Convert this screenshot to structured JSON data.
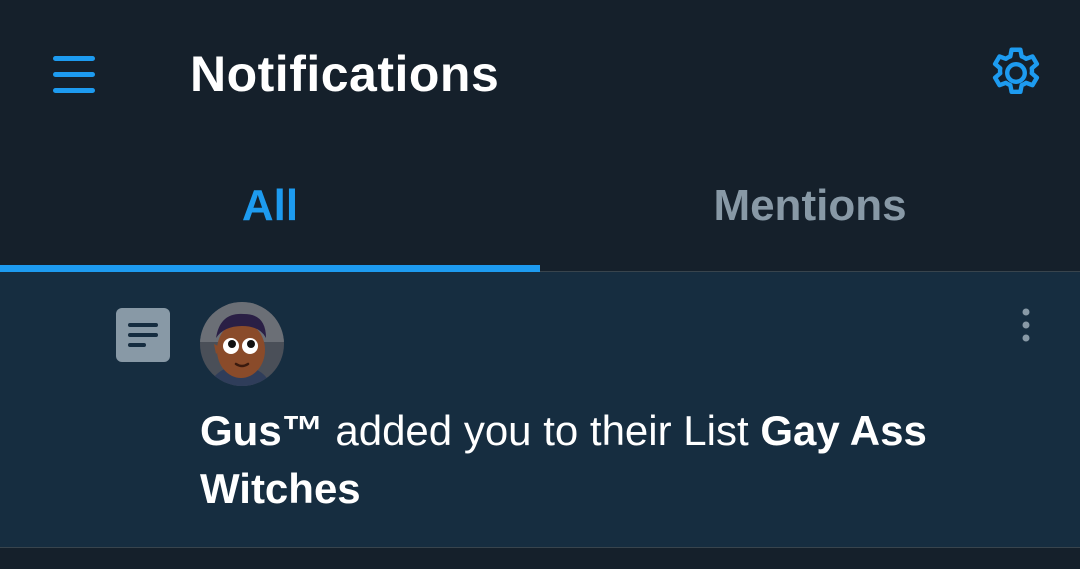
{
  "header": {
    "title": "Notifications",
    "menu_icon": "hamburger-menu-icon",
    "settings_icon": "gear-icon"
  },
  "tabs": [
    {
      "label": "All",
      "active": true
    },
    {
      "label": "Mentions",
      "active": false
    }
  ],
  "notification": {
    "type_icon": "list-icon",
    "user_name": "Gus™",
    "action_text": " added you to their List ",
    "list_name": "Gay Ass Witches",
    "more_icon": "more-vertical-icon"
  },
  "colors": {
    "background": "#15202b",
    "notification_background": "#162d40",
    "accent": "#1d9bf0",
    "inactive_tab": "#8899a6",
    "divider": "#38444d"
  }
}
